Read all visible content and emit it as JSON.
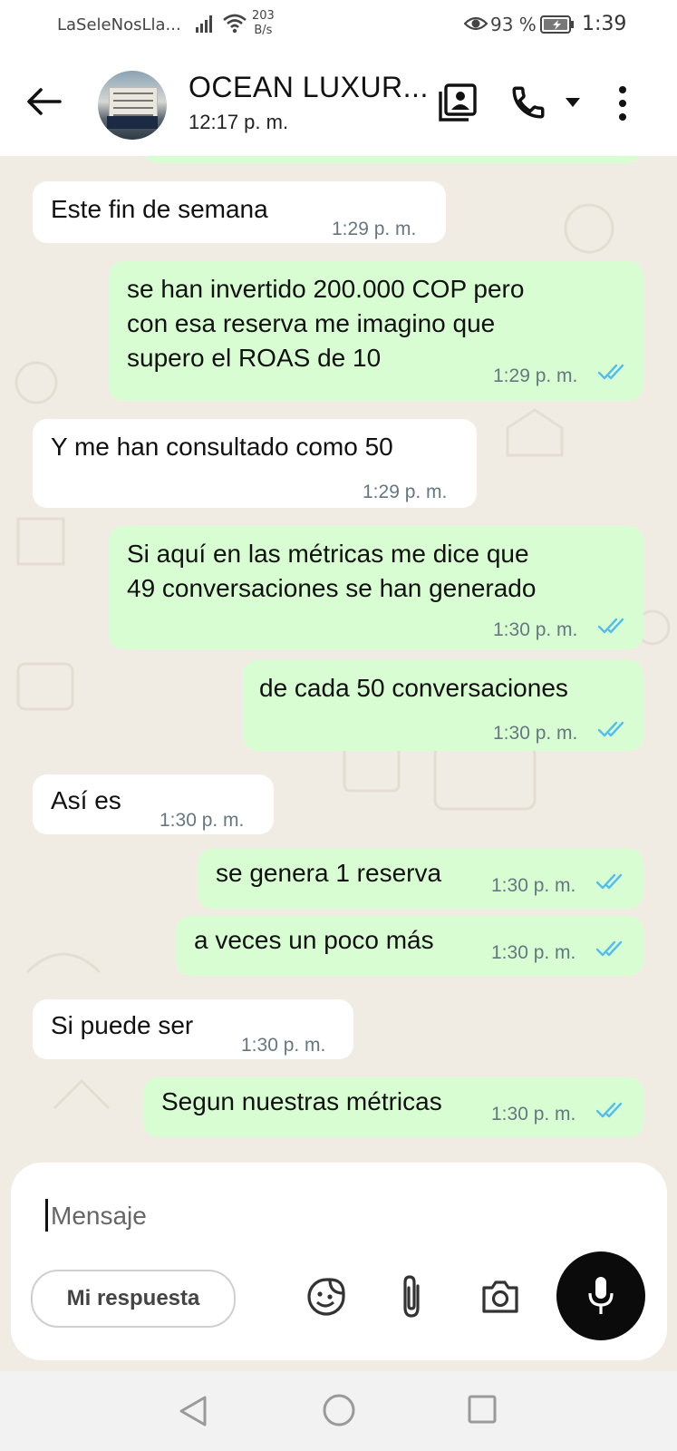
{
  "status_bar": {
    "carrier": "LaSeleNosLla...",
    "net_speed_value": "203",
    "net_speed_unit": "B/s",
    "battery": "93 %",
    "time": "1:39"
  },
  "header": {
    "contact_name": "OCEAN LUXUR...",
    "subtitle": "12:17 p. m."
  },
  "messages": [
    {
      "dir": "in",
      "text": "Este fin de semana",
      "time": "1:29 p. m."
    },
    {
      "dir": "out",
      "lines": [
        "se han invertido 200.000 COP pero",
        "con esa reserva me imagino que",
        "supero el ROAS de 10"
      ],
      "time": "1:29 p. m."
    },
    {
      "dir": "in",
      "text": "Y me han consultado como 50",
      "time": "1:29 p. m."
    },
    {
      "dir": "out",
      "lines": [
        "Si aquí en las métricas me dice que",
        "49 conversaciones se han generado"
      ],
      "time": "1:30 p. m."
    },
    {
      "dir": "out",
      "text": "de cada 50 conversaciones",
      "time": "1:30 p. m."
    },
    {
      "dir": "in",
      "text": "Así es",
      "time": "1:30 p. m."
    },
    {
      "dir": "out",
      "text": "se genera 1 reserva",
      "time": "1:30 p. m."
    },
    {
      "dir": "out",
      "text": "a veces un poco más",
      "time": "1:30 p. m."
    },
    {
      "dir": "in",
      "text": "Si puede ser",
      "time": "1:30 p. m."
    },
    {
      "dir": "out",
      "text": "Segun nuestras métricas",
      "time": "1:30 p. m."
    }
  ],
  "composer": {
    "placeholder": "Mensaje",
    "reply_chip": "Mi respuesta"
  },
  "colors": {
    "incoming_bubble": "#ffffff",
    "outgoing_bubble": "#d9fdd3",
    "read_ticks": "#53bdeb",
    "chat_background": "#f1ece3"
  },
  "icons": [
    "signal-icon",
    "wifi-icon",
    "eye-icon",
    "battery-icon",
    "back-arrow-icon",
    "contact-card-icon",
    "phone-icon",
    "dropdown-icon",
    "more-options-icon",
    "sticker-icon",
    "paperclip-icon",
    "camera-icon",
    "microphone-icon",
    "nav-back-icon",
    "nav-home-icon",
    "nav-recents-icon"
  ]
}
